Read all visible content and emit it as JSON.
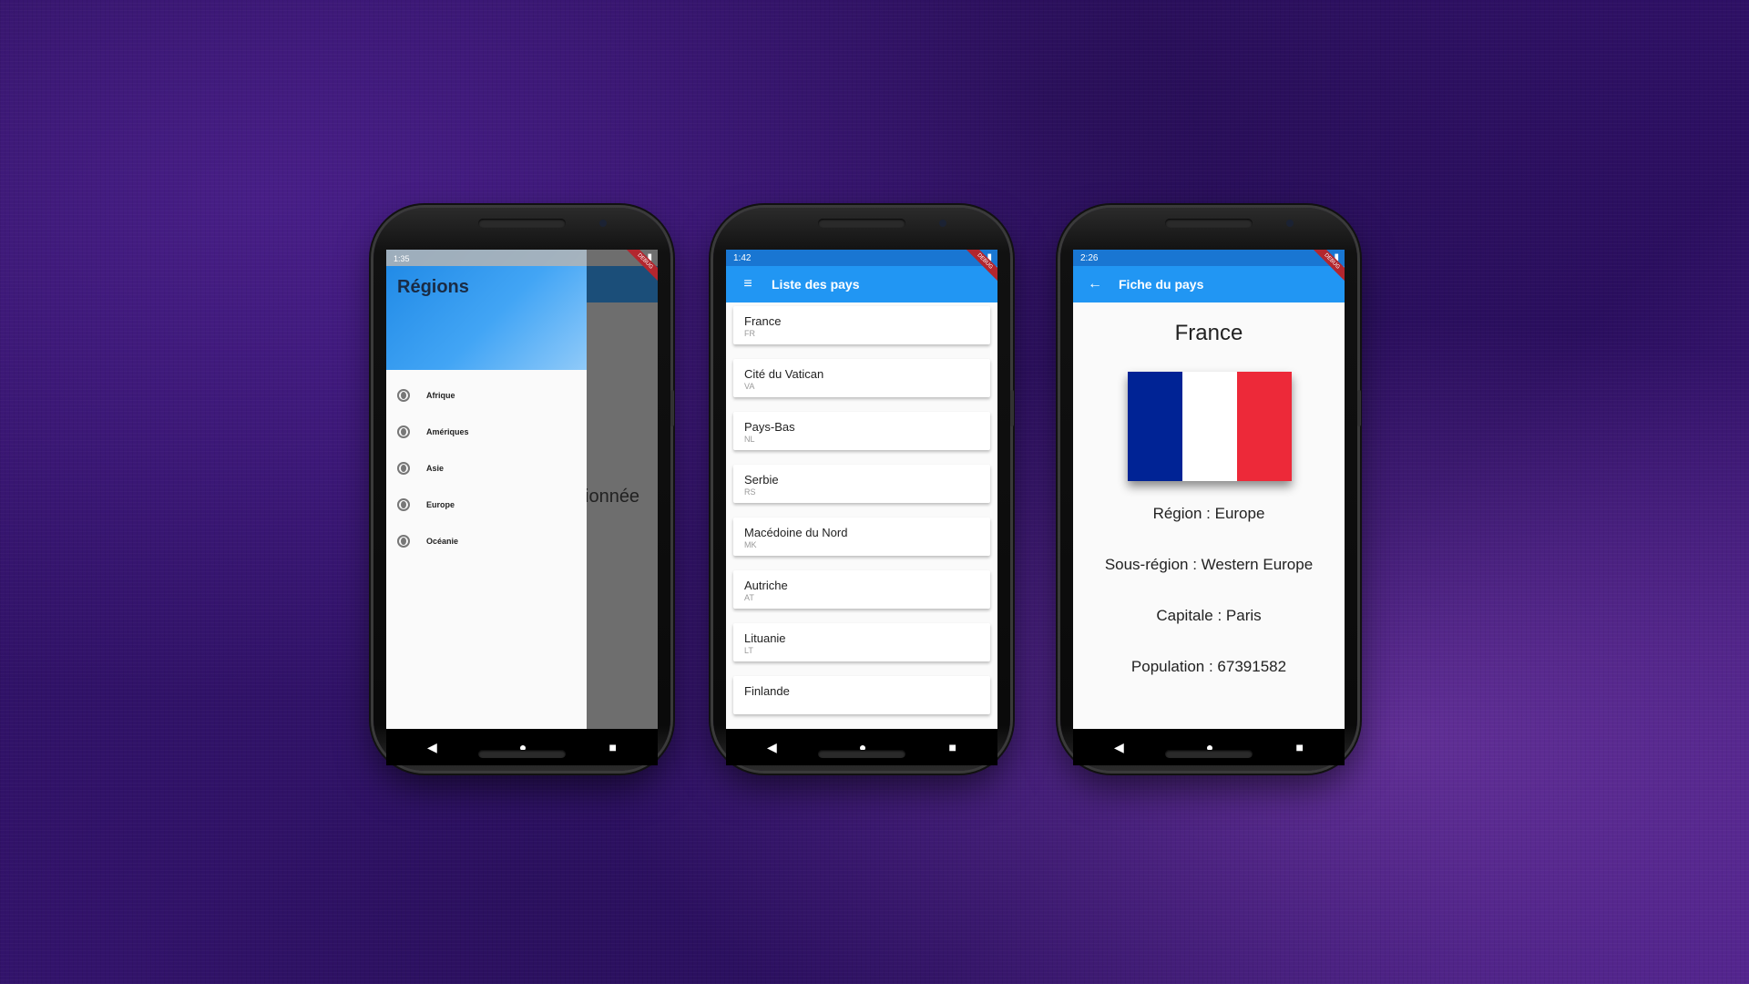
{
  "colors": {
    "primary": "#2196f3",
    "flag_blue": "#002395",
    "flag_white": "#ffffff",
    "flag_red": "#ed2939"
  },
  "phone1": {
    "status_time": "1:35",
    "drawer_title": "Régions",
    "regions": [
      "Afrique",
      "Amériques",
      "Asie",
      "Europe",
      "Océanie"
    ],
    "background_text": "ionnée"
  },
  "phone2": {
    "status_time": "1:42",
    "app_title": "Liste des pays",
    "countries": [
      {
        "name": "France",
        "code": "FR"
      },
      {
        "name": "Cité du Vatican",
        "code": "VA"
      },
      {
        "name": "Pays-Bas",
        "code": "NL"
      },
      {
        "name": "Serbie",
        "code": "RS"
      },
      {
        "name": "Macédoine du Nord",
        "code": "MK"
      },
      {
        "name": "Autriche",
        "code": "AT"
      },
      {
        "name": "Lituanie",
        "code": "LT"
      },
      {
        "name": "Finlande",
        "code": ""
      }
    ]
  },
  "phone3": {
    "status_time": "2:26",
    "app_title": "Fiche du pays",
    "country_name": "France",
    "region": "Région : Europe",
    "subregion": "Sous-région : Western Europe",
    "capital": "Capitale : Paris",
    "population": "Population : 67391582"
  },
  "debug_banner": "DEBUG"
}
